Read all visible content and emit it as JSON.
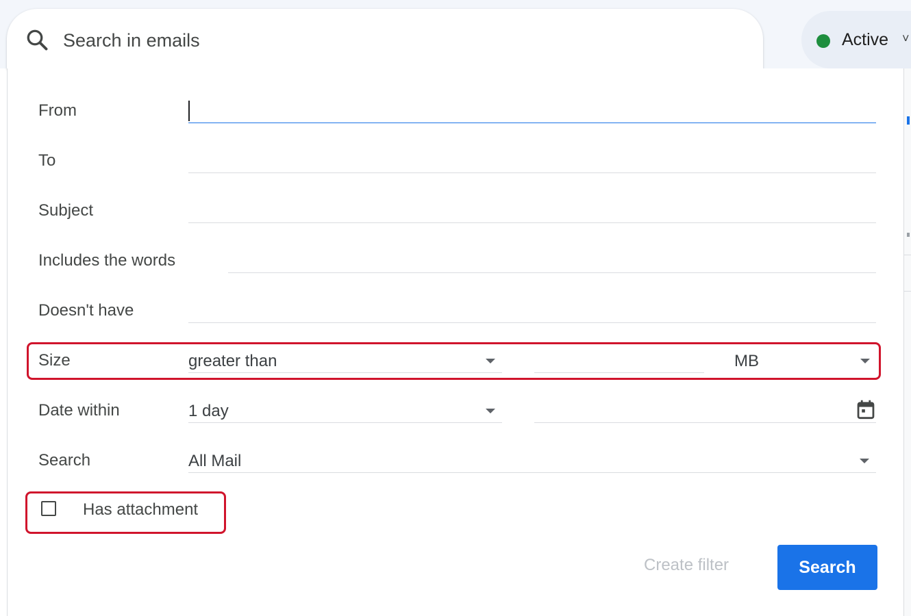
{
  "search": {
    "placeholder": "Search in emails",
    "icon": "search-icon"
  },
  "status": {
    "label": "Active",
    "color": "#1e8e3e",
    "chevron": "˅"
  },
  "form": {
    "from": {
      "label": "From",
      "value": ""
    },
    "to": {
      "label": "To",
      "value": ""
    },
    "subject": {
      "label": "Subject",
      "value": ""
    },
    "includes": {
      "label": "Includes the words",
      "value": ""
    },
    "doesnt_have": {
      "label": "Doesn't have",
      "value": ""
    },
    "size": {
      "label": "Size",
      "operator": "greater than",
      "value": "",
      "unit": "MB"
    },
    "date_within": {
      "label": "Date within",
      "range": "1 day",
      "date": ""
    },
    "search_in": {
      "label": "Search",
      "value": "All Mail"
    },
    "has_attachment": {
      "label": "Has attachment",
      "checked": false
    }
  },
  "actions": {
    "create_filter_label": "Create filter",
    "search_label": "Search"
  },
  "colors": {
    "accent": "#1a73e8",
    "highlight": "#d0142c",
    "status_green": "#1e8e3e"
  }
}
